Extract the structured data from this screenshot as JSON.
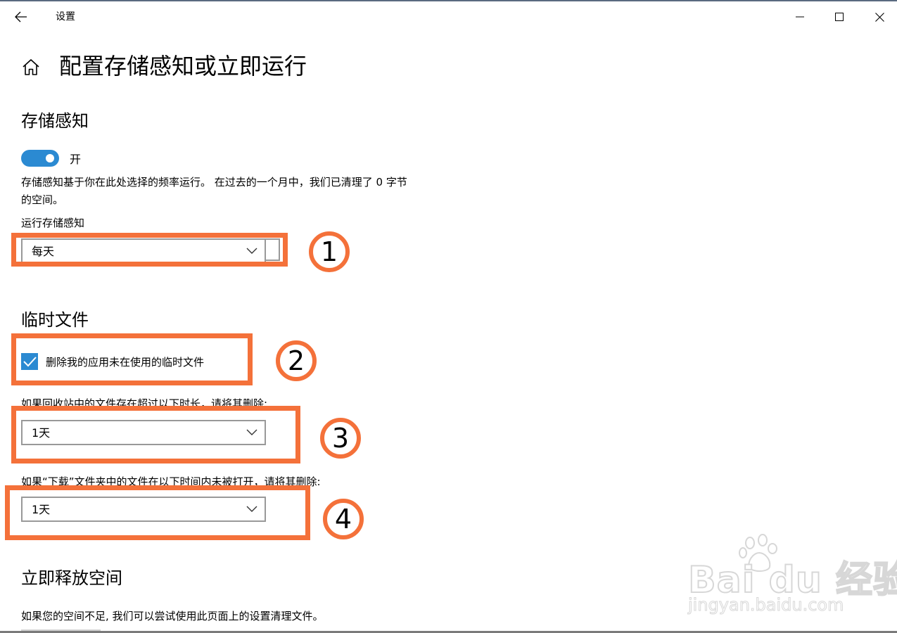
{
  "window": {
    "app_title": "设置"
  },
  "page": {
    "title": "配置存储感知或立即运行"
  },
  "storage_sense": {
    "heading": "存储感知",
    "toggle_state": "开",
    "toggle_on": true,
    "description": "存储感知基于你在此处选择的频率运行。 在过去的一个月中，我们已清理了 0 字节 的空间。",
    "run_label": "运行存储感知",
    "run_value": "每天"
  },
  "temp_files": {
    "heading": "临时文件",
    "delete_checkbox_label": "删除我的应用未在使用的临时文件",
    "delete_checked": true,
    "recycle_label": "如果回收站中的文件存在超过以下时长，请将其删除:",
    "recycle_value": "1天",
    "downloads_label": "如果“下载”文件夹中的文件在以下时间内未被打开，请将其删除:",
    "downloads_value": "1天"
  },
  "free_space": {
    "heading": "立即释放空间",
    "description": "如果您的空间不足, 我们可以尝试使用此页面上的设置清理文件。"
  },
  "annotations": {
    "color": "#f4713a",
    "marks": [
      "1",
      "2",
      "3",
      "4"
    ]
  },
  "watermark": {
    "logo": "Bai du 经验",
    "url": "jingyan.baidu.com"
  },
  "colors": {
    "accent": "#2b8ad2"
  }
}
